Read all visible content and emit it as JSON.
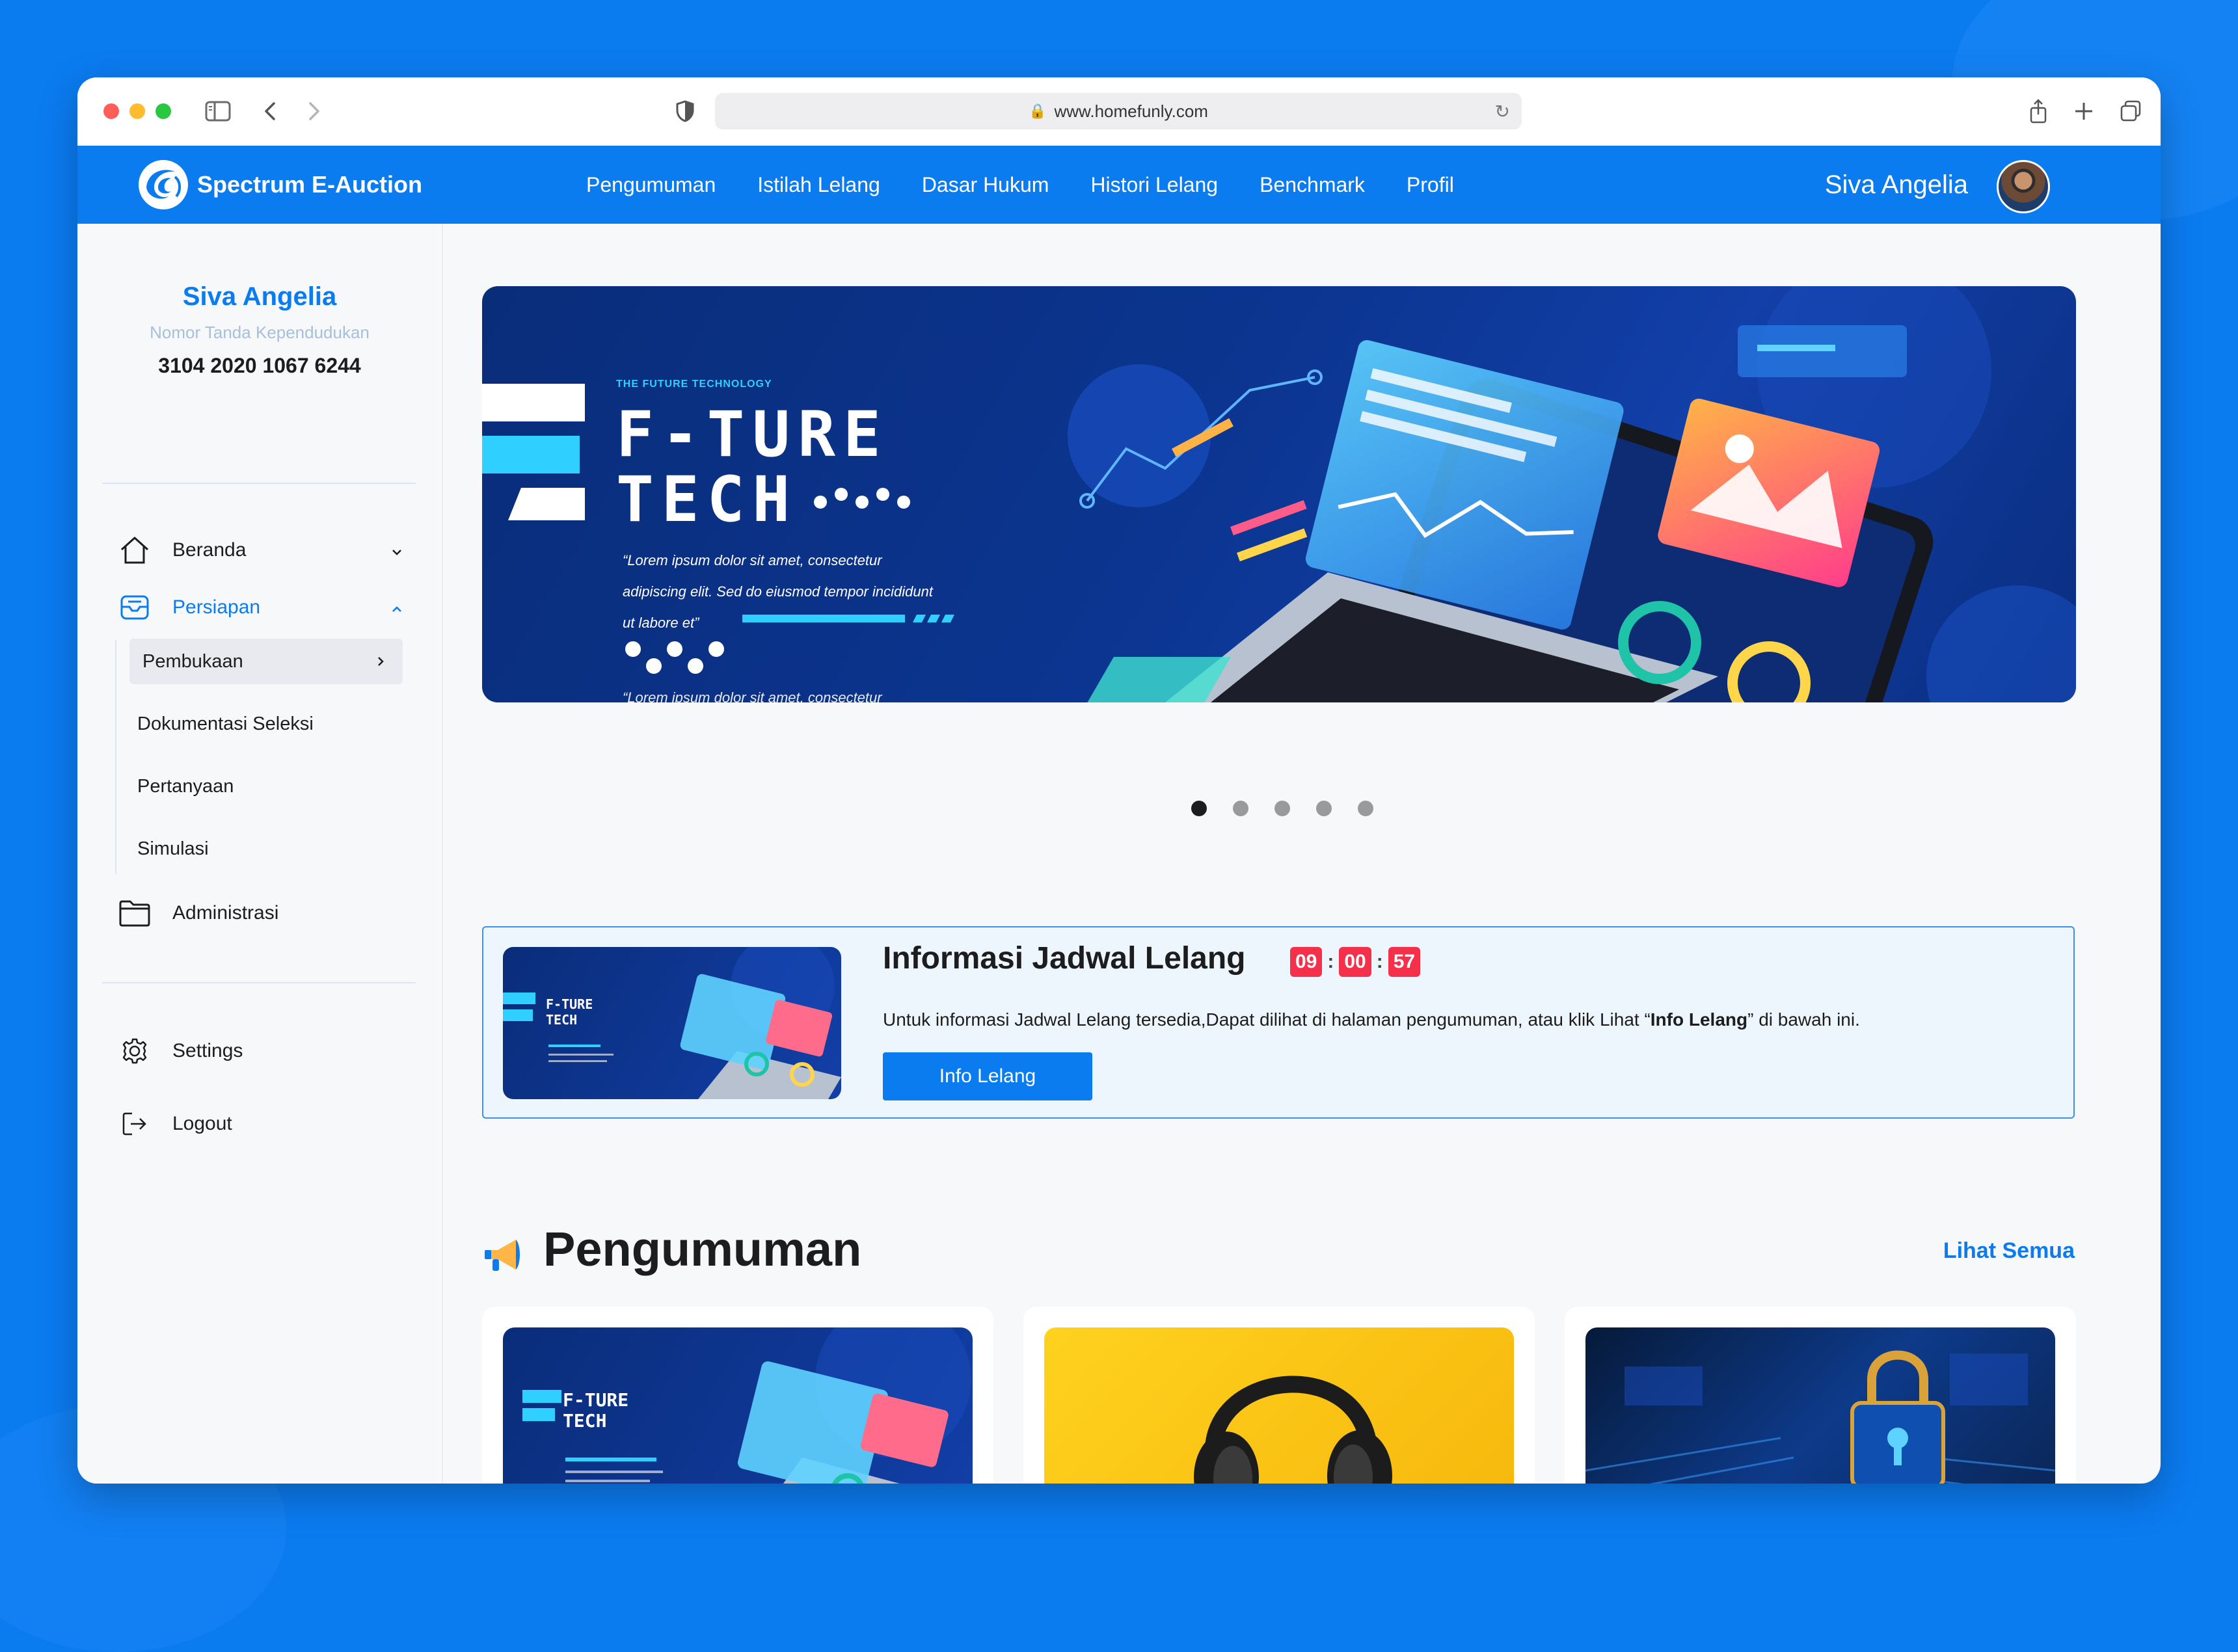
{
  "browser": {
    "url": "www.homefunly.com"
  },
  "app": {
    "brand": "Spectrum E-Auction",
    "menu": [
      "Pengumuman",
      "Istilah Lelang",
      "Dasar Hukum",
      "Histori Lelang",
      "Benchmark",
      "Profil"
    ],
    "user_name": "Siva Angelia"
  },
  "sidebar": {
    "name": "Siva Angelia",
    "nik_label": "Nomor Tanda Kependudukan",
    "nik_value": "3104 2020 1067 6244",
    "items": {
      "beranda": "Beranda",
      "persiapan": "Persiapan",
      "administrasi": "Administrasi",
      "settings": "Settings",
      "logout": "Logout"
    },
    "sub_items": [
      "Pembukaan",
      "Dokumentasi Seleksi",
      "Pertanyaan",
      "Simulasi"
    ]
  },
  "banner": {
    "kicker": "THE FUTURE TECHNOLOGY",
    "title_line1": "F-TURE",
    "title_line2": "TECH",
    "quote_line1": "“Lorem ipsum dolor sit amet, consectetur",
    "quote_line2": "adipiscing elit. Sed do eiusmod tempor incididunt",
    "quote_line3": "ut labore et”",
    "quote_cut": "“Lorem ipsum dolor sit amet, consectetur",
    "slides": 5,
    "active_slide": 1
  },
  "jadwal": {
    "title": "Informasi Jadwal Lelang",
    "timer": {
      "hours": "09",
      "minutes": "00",
      "seconds": "57"
    },
    "desc_before": "Untuk informasi Jadwal Lelang tersedia,Dapat dilihat di halaman pengumuman, atau klik Lihat “",
    "desc_bold": "Info Lelang",
    "desc_after": "” di bawah ini.",
    "button": "Info Lelang",
    "thumb_title1": "F-TURE",
    "thumb_title2": "TECH"
  },
  "pengumuman": {
    "title": "Pengumuman",
    "see_all": "Lihat Semua",
    "card1_title1": "F-TURE",
    "card1_title2": "TECH"
  },
  "colors": {
    "primary": "#0b7bf0",
    "timer": "#f5304a",
    "success": "#34c759"
  }
}
